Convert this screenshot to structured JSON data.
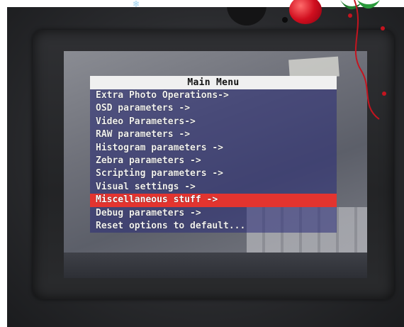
{
  "camera_menu": {
    "title": "Main Menu",
    "items": [
      "Extra Photo Operations->",
      "OSD parameters ->",
      "Video Parameters->",
      "RAW parameters ->",
      "Histogram parameters ->",
      "Zebra parameters ->",
      "Scripting parameters ->",
      "Visual settings ->",
      "Miscellaneous stuff ->",
      "Debug parameters ->",
      "Reset options to default..."
    ],
    "selected_index": 8,
    "colors": {
      "title_bg": "#f0f0f0",
      "item_text": "#f2f2f2",
      "highlight": "#e3342f"
    }
  },
  "decorations": [
    "snowflake-icon",
    "ornament-icon",
    "holly-leaves-icon",
    "vine-icon"
  ]
}
